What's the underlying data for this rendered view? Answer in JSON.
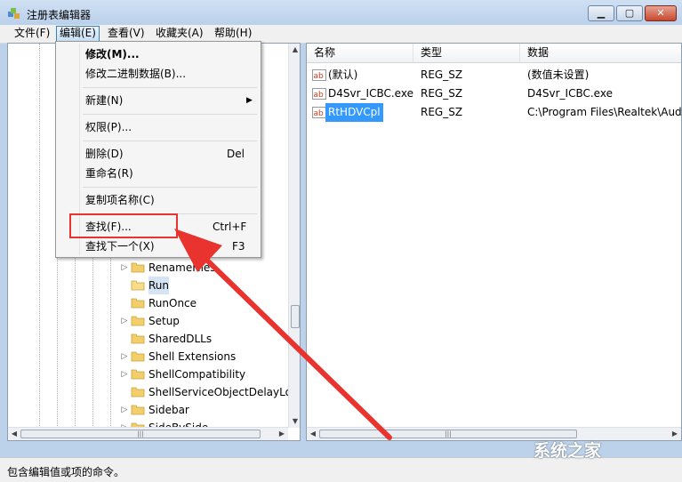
{
  "window": {
    "title": "注册表编辑器",
    "controls": {
      "minimize": "▁",
      "maximize": "▢",
      "close": "✕"
    }
  },
  "menubar": {
    "items": [
      {
        "label": "文件(F)"
      },
      {
        "label": "编辑(E)"
      },
      {
        "label": "查看(V)"
      },
      {
        "label": "收藏夹(A)"
      },
      {
        "label": "帮助(H)"
      }
    ]
  },
  "edit_menu": {
    "items": [
      {
        "label": "修改(M)...",
        "shortcut": ""
      },
      {
        "label": "修改二进制数据(B)...",
        "shortcut": ""
      },
      {
        "label": "新建(N)",
        "shortcut": ""
      },
      {
        "label": "权限(P)...",
        "shortcut": ""
      },
      {
        "label": "删除(D)",
        "shortcut": "Del"
      },
      {
        "label": "重命名(R)",
        "shortcut": ""
      },
      {
        "label": "复制项名称(C)",
        "shortcut": ""
      },
      {
        "label": "查找(F)...",
        "shortcut": "Ctrl+F"
      },
      {
        "label": "查找下一个(X)",
        "shortcut": "F3"
      }
    ]
  },
  "tree": {
    "items": [
      {
        "label": "RenameFiles",
        "selected": false
      },
      {
        "label": "Run",
        "selected": true
      },
      {
        "label": "RunOnce",
        "selected": false
      },
      {
        "label": "Setup",
        "selected": false
      },
      {
        "label": "SharedDLLs",
        "selected": false
      },
      {
        "label": "Shell Extensions",
        "selected": false
      },
      {
        "label": "ShellCompatibility",
        "selected": false
      },
      {
        "label": "ShellServiceObjectDelayLoad",
        "selected": false
      },
      {
        "label": "Sidebar",
        "selected": false
      },
      {
        "label": "SideBySide",
        "selected": false
      }
    ]
  },
  "values_pane": {
    "columns": [
      "名称",
      "类型",
      "数据"
    ],
    "rows": [
      {
        "name": "(默认)",
        "type": "REG_SZ",
        "data": "(数值未设置)",
        "selected": false
      },
      {
        "name": "D4Svr_ICBC.exe",
        "type": "REG_SZ",
        "data": "D4Svr_ICBC.exe",
        "selected": false
      },
      {
        "name": "RtHDVCpl",
        "type": "REG_SZ",
        "data": "C:\\Program Files\\Realtek\\Audio",
        "selected": true
      }
    ]
  },
  "statusbar": {
    "text": "包含编辑值或项的命令。"
  },
  "watermark": {
    "text": "系统之家"
  },
  "colors": {
    "highlight_box": "#e8332e",
    "arrow": "#e8332e",
    "selection": "#3399ff"
  }
}
